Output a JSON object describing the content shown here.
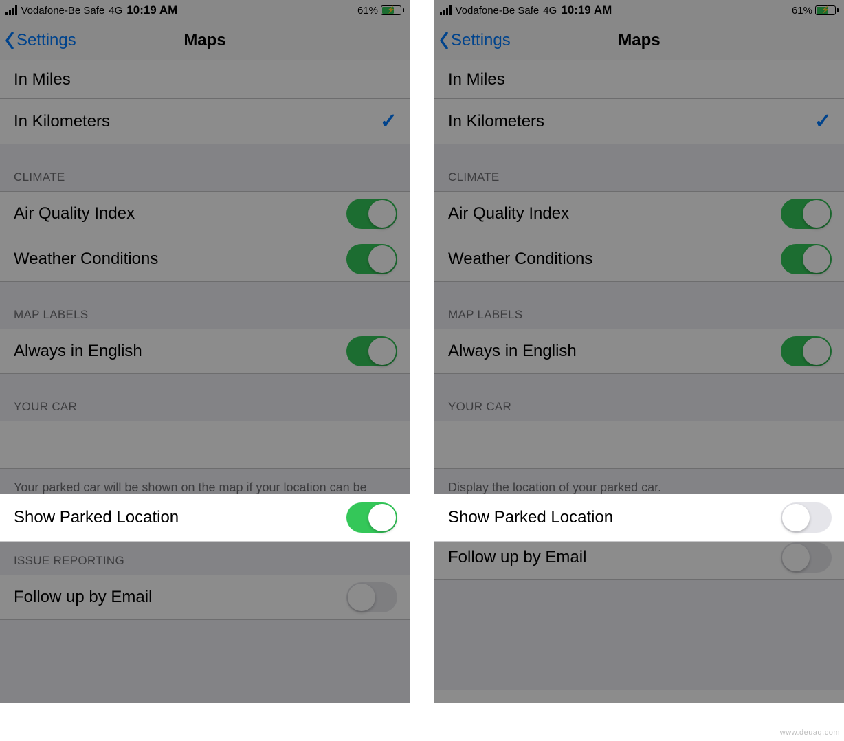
{
  "status": {
    "carrier": "Vodafone-Be Safe",
    "network": "4G",
    "time": "10:19 AM",
    "battery_pct": "61%"
  },
  "nav": {
    "back_label": "Settings",
    "title": "Maps"
  },
  "distance": {
    "miles_label": "In Miles",
    "km_label": "In Kilometers"
  },
  "climate": {
    "header": "CLIMATE",
    "aqi_label": "Air Quality Index",
    "weather_label": "Weather Conditions"
  },
  "map_labels": {
    "header": "MAP LABELS",
    "english_label": "Always in English"
  },
  "your_car": {
    "header": "YOUR CAR",
    "parked_label": "Show Parked Location",
    "footer_on": "Your parked car will be shown on the map if your location can be determined when parking. A connection to your car's Bluetooth or CarPlay stereo is required.",
    "footer_off": "Display the location of your parked car."
  },
  "issue_reporting": {
    "header": "ISSUE REPORTING",
    "followup_label": "Follow up by Email"
  },
  "watermark": "www.deuaq.com"
}
